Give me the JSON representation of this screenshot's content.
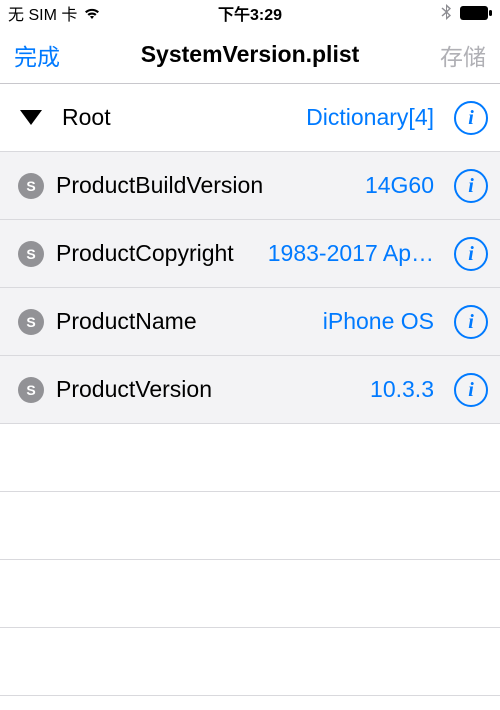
{
  "status": {
    "carrier": "无 SIM 卡",
    "time": "下午3:29"
  },
  "nav": {
    "done": "完成",
    "title": "SystemVersion.plist",
    "save": "存储"
  },
  "root": {
    "key": "Root",
    "value": "Dictionary[4]"
  },
  "rows": [
    {
      "badge": "S",
      "key": "ProductBuildVersion",
      "value": "14G60"
    },
    {
      "badge": "S",
      "key": "ProductCopyright",
      "value": "1983-2017 Ap…"
    },
    {
      "badge": "S",
      "key": "ProductName",
      "value": "iPhone OS"
    },
    {
      "badge": "S",
      "key": "ProductVersion",
      "value": "10.3.3"
    }
  ]
}
